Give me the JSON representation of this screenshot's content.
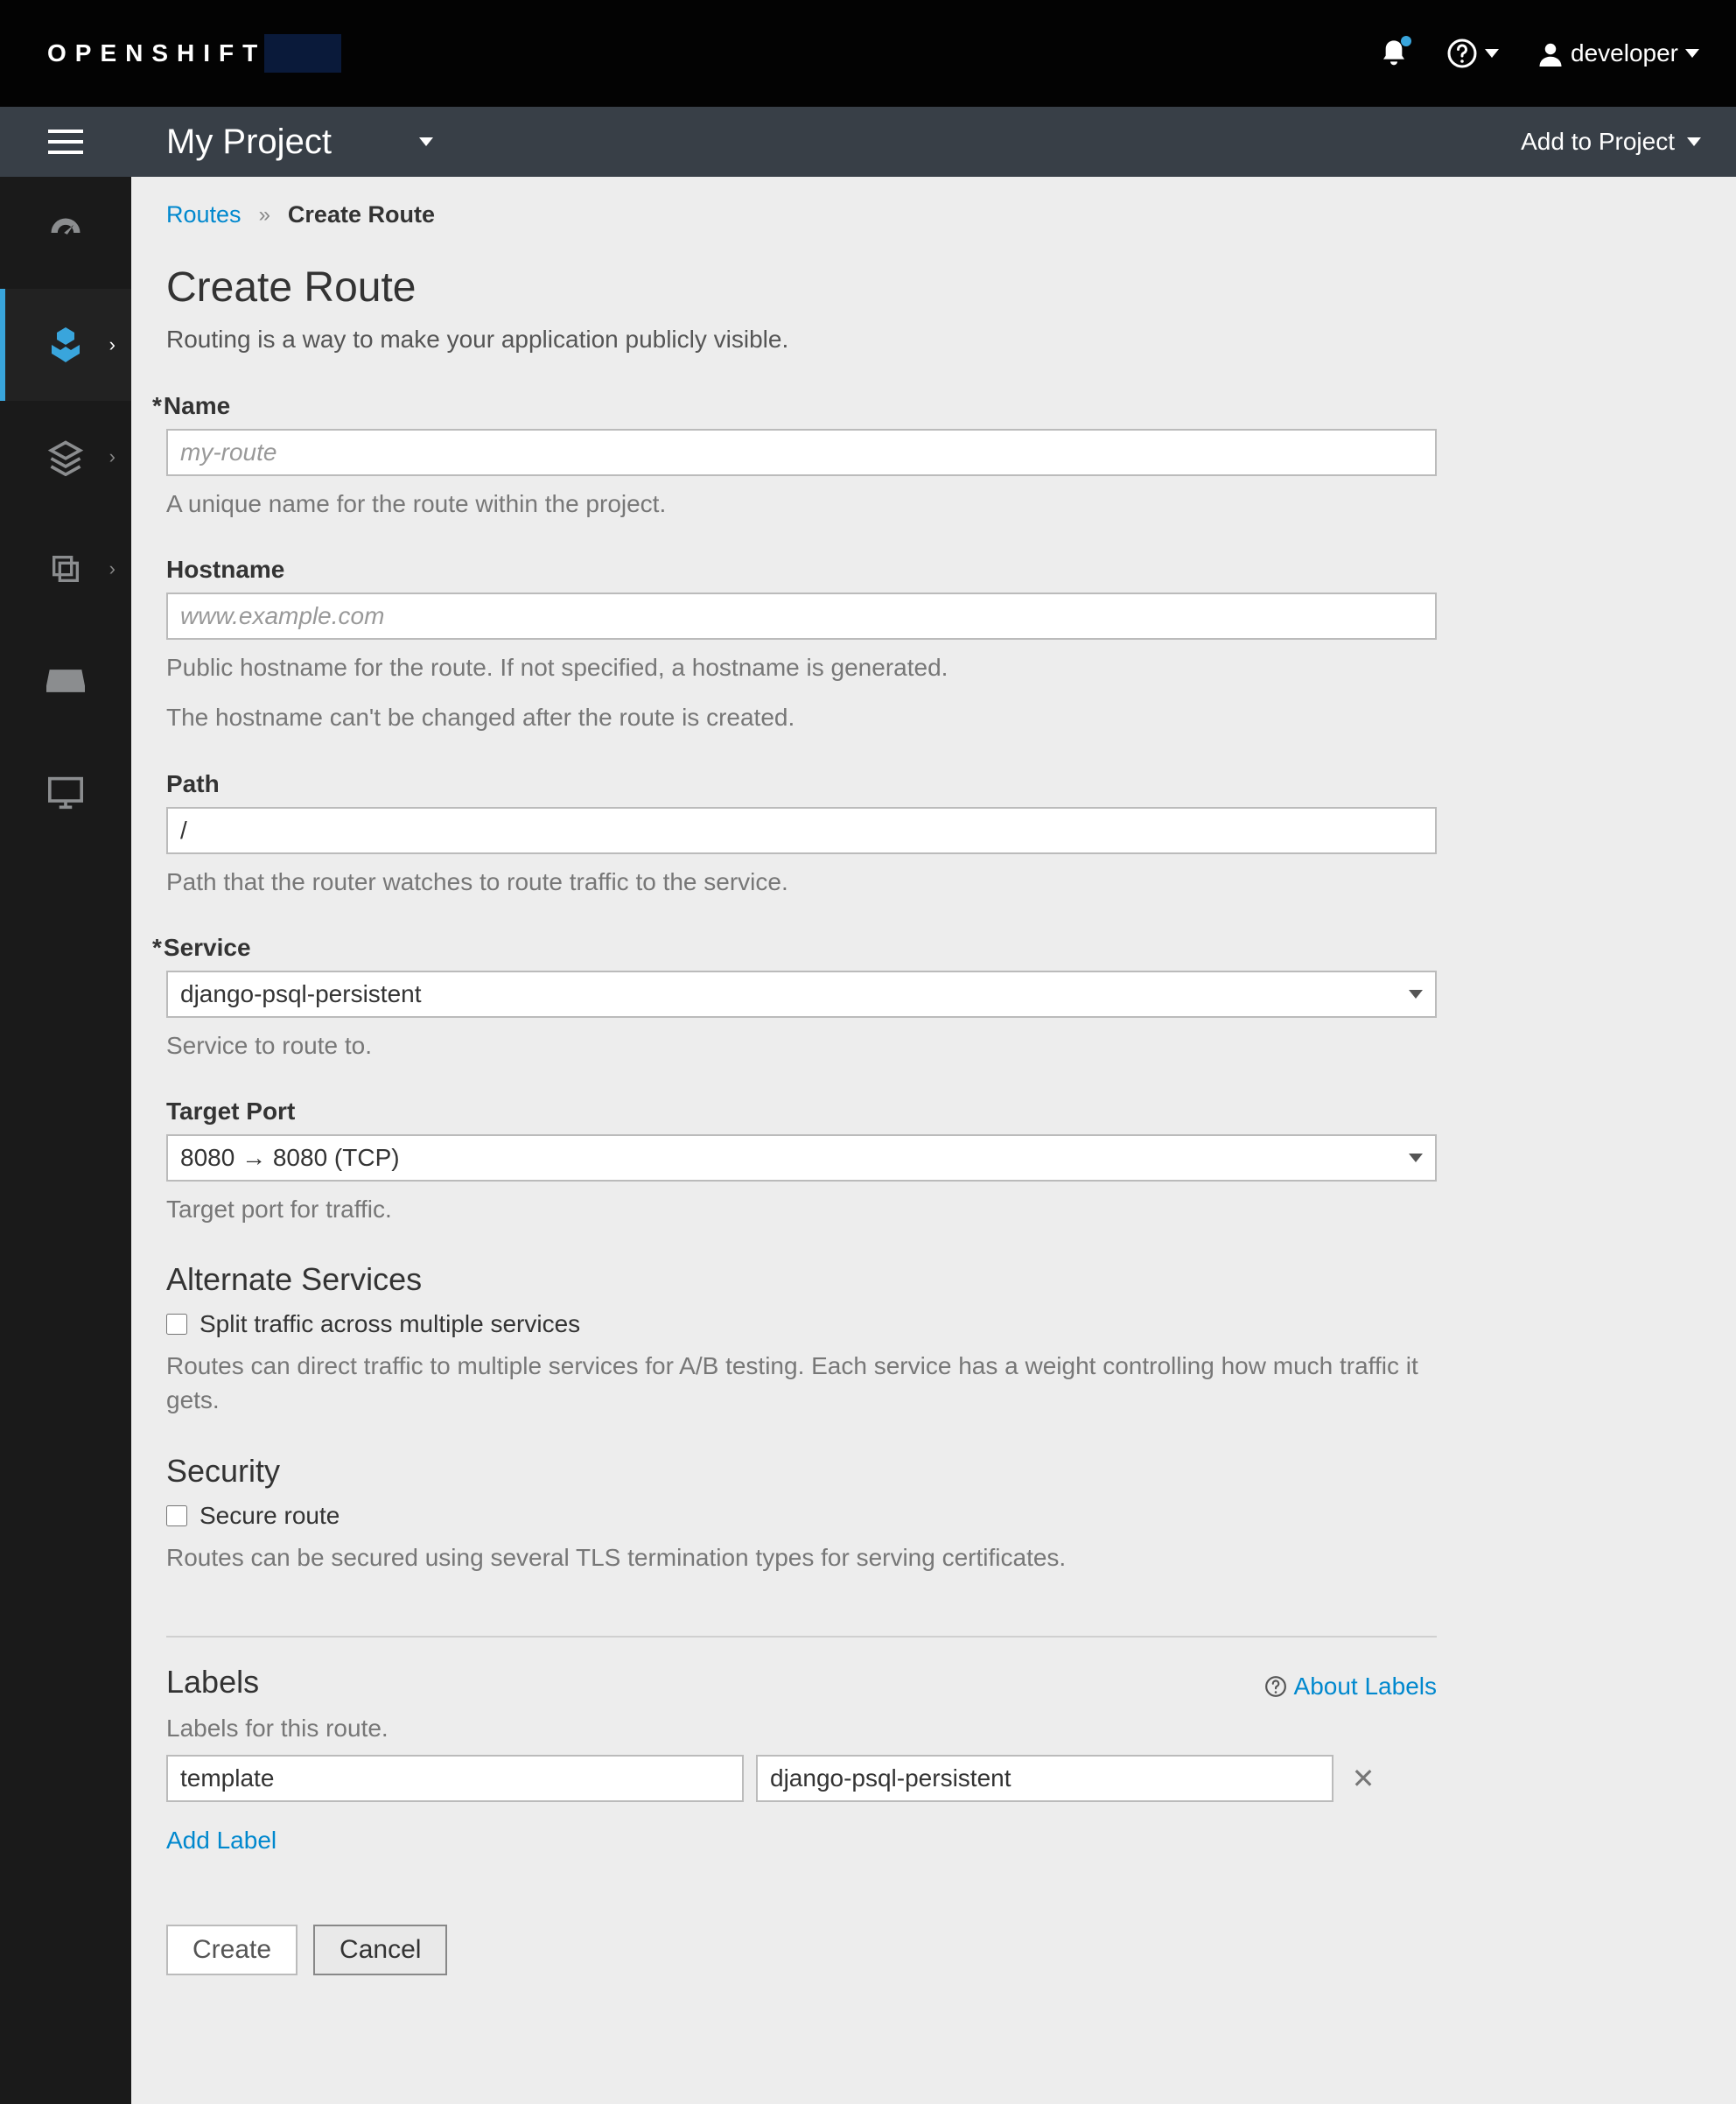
{
  "brand": {
    "name": "OPENSHIFT"
  },
  "user": {
    "name": "developer"
  },
  "project_bar": {
    "project_name": "My Project",
    "add_label": "Add to Project"
  },
  "breadcrumb": {
    "routes": "Routes",
    "current": "Create Route"
  },
  "page": {
    "title": "Create Route",
    "description": "Routing is a way to make your application publicly visible."
  },
  "form": {
    "name": {
      "label": "Name",
      "placeholder": "my-route",
      "help": "A unique name for the route within the project."
    },
    "hostname": {
      "label": "Hostname",
      "placeholder": "www.example.com",
      "help1": "Public hostname for the route. If not specified, a hostname is generated.",
      "help2": "The hostname can't be changed after the route is created."
    },
    "path": {
      "label": "Path",
      "value": "/",
      "help": "Path that the router watches to route traffic to the service."
    },
    "service": {
      "label": "Service",
      "value": "django-psql-persistent",
      "help": "Service to route to."
    },
    "target_port": {
      "label": "Target Port",
      "value": "8080 → 8080 (TCP)",
      "help": "Target port for traffic."
    },
    "alt_services": {
      "title": "Alternate Services",
      "checkbox_label": "Split traffic across multiple services",
      "help": "Routes can direct traffic to multiple services for A/B testing. Each service has a weight controlling how much traffic it gets."
    },
    "security": {
      "title": "Security",
      "checkbox_label": "Secure route",
      "help": "Routes can be secured using several TLS termination types for serving certificates."
    }
  },
  "labels_section": {
    "title": "Labels",
    "about": "About Labels",
    "subtext": "Labels for this route.",
    "row": {
      "key": "template",
      "value": "django-psql-persistent"
    },
    "add": "Add Label"
  },
  "actions": {
    "create": "Create",
    "cancel": "Cancel"
  }
}
